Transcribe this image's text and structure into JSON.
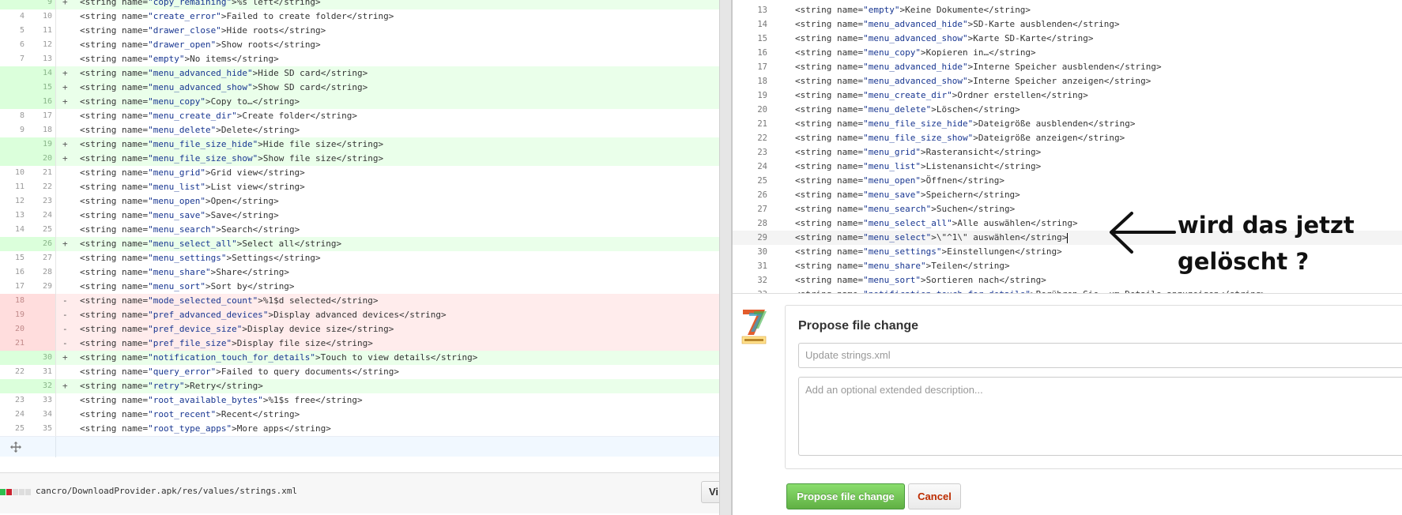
{
  "diff": {
    "lines": [
      {
        "type": "add",
        "old": "",
        "new": "9",
        "marker": "+",
        "name": "copy_remaining",
        "text": "%s left"
      },
      {
        "type": "ctx",
        "old": "4",
        "new": "10",
        "marker": "",
        "name": "create_error",
        "text": "Failed to create folder"
      },
      {
        "type": "ctx",
        "old": "5",
        "new": "11",
        "marker": "",
        "name": "drawer_close",
        "text": "Hide roots"
      },
      {
        "type": "ctx",
        "old": "6",
        "new": "12",
        "marker": "",
        "name": "drawer_open",
        "text": "Show roots"
      },
      {
        "type": "ctx",
        "old": "7",
        "new": "13",
        "marker": "",
        "name": "empty",
        "text": "No items"
      },
      {
        "type": "add",
        "old": "",
        "new": "14",
        "marker": "+",
        "name": "menu_advanced_hide",
        "text": "Hide SD card"
      },
      {
        "type": "add",
        "old": "",
        "new": "15",
        "marker": "+",
        "name": "menu_advanced_show",
        "text": "Show SD card"
      },
      {
        "type": "add",
        "old": "",
        "new": "16",
        "marker": "+",
        "name": "menu_copy",
        "text": "Copy to…"
      },
      {
        "type": "ctx",
        "old": "8",
        "new": "17",
        "marker": "",
        "name": "menu_create_dir",
        "text": "Create folder"
      },
      {
        "type": "ctx",
        "old": "9",
        "new": "18",
        "marker": "",
        "name": "menu_delete",
        "text": "Delete"
      },
      {
        "type": "add",
        "old": "",
        "new": "19",
        "marker": "+",
        "name": "menu_file_size_hide",
        "text": "Hide file size"
      },
      {
        "type": "add",
        "old": "",
        "new": "20",
        "marker": "+",
        "name": "menu_file_size_show",
        "text": "Show file size"
      },
      {
        "type": "ctx",
        "old": "10",
        "new": "21",
        "marker": "",
        "name": "menu_grid",
        "text": "Grid view"
      },
      {
        "type": "ctx",
        "old": "11",
        "new": "22",
        "marker": "",
        "name": "menu_list",
        "text": "List view"
      },
      {
        "type": "ctx",
        "old": "12",
        "new": "23",
        "marker": "",
        "name": "menu_open",
        "text": "Open"
      },
      {
        "type": "ctx",
        "old": "13",
        "new": "24",
        "marker": "",
        "name": "menu_save",
        "text": "Save"
      },
      {
        "type": "ctx",
        "old": "14",
        "new": "25",
        "marker": "",
        "name": "menu_search",
        "text": "Search"
      },
      {
        "type": "add",
        "old": "",
        "new": "26",
        "marker": "+",
        "name": "menu_select_all",
        "text": "Select all"
      },
      {
        "type": "ctx",
        "old": "15",
        "new": "27",
        "marker": "",
        "name": "menu_settings",
        "text": "Settings"
      },
      {
        "type": "ctx",
        "old": "16",
        "new": "28",
        "marker": "",
        "name": "menu_share",
        "text": "Share"
      },
      {
        "type": "ctx",
        "old": "17",
        "new": "29",
        "marker": "",
        "name": "menu_sort",
        "text": "Sort by"
      },
      {
        "type": "del",
        "old": "18",
        "new": "",
        "marker": "-",
        "name": "mode_selected_count",
        "text": "%1$d selected"
      },
      {
        "type": "del",
        "old": "19",
        "new": "",
        "marker": "-",
        "name": "pref_advanced_devices",
        "text": "Display advanced devices"
      },
      {
        "type": "del",
        "old": "20",
        "new": "",
        "marker": "-",
        "name": "pref_device_size",
        "text": "Display device size"
      },
      {
        "type": "del",
        "old": "21",
        "new": "",
        "marker": "-",
        "name": "pref_file_size",
        "text": "Display file size"
      },
      {
        "type": "add",
        "old": "",
        "new": "30",
        "marker": "+",
        "name": "notification_touch_for_details",
        "text": "Touch to view details"
      },
      {
        "type": "ctx",
        "old": "22",
        "new": "31",
        "marker": "",
        "name": "query_error",
        "text": "Failed to query documents"
      },
      {
        "type": "add",
        "old": "",
        "new": "32",
        "marker": "+",
        "name": "retry",
        "text": "Retry"
      },
      {
        "type": "ctx",
        "old": "23",
        "new": "33",
        "marker": "",
        "name": "root_available_bytes",
        "text": "%1$s free"
      },
      {
        "type": "ctx",
        "old": "24",
        "new": "34",
        "marker": "",
        "name": "root_recent",
        "text": "Recent"
      },
      {
        "type": "ctx",
        "old": "25",
        "new": "35",
        "marker": "",
        "name": "root_type_apps",
        "text": "More apps"
      }
    ],
    "file_path": "cancro/DownloadProvider.apk/res/values/strings.xml",
    "view_button": "Vi"
  },
  "editor": {
    "lines": [
      {
        "num": "13",
        "name": "empty",
        "text": "Keine Dokumente"
      },
      {
        "num": "14",
        "name": "menu_advanced_hide",
        "text": "SD-Karte ausblenden"
      },
      {
        "num": "15",
        "name": "menu_advanced_show",
        "text": "Karte SD-Karte"
      },
      {
        "num": "16",
        "name": "menu_copy",
        "text": "Kopieren in…"
      },
      {
        "num": "17",
        "name": "menu_advanced_hide",
        "text": "Interne Speicher ausblenden"
      },
      {
        "num": "18",
        "name": "menu_advanced_show",
        "text": "Interne Speicher anzeigen"
      },
      {
        "num": "19",
        "name": "menu_create_dir",
        "text": "Ordner erstellen"
      },
      {
        "num": "20",
        "name": "menu_delete",
        "text": "Löschen"
      },
      {
        "num": "21",
        "name": "menu_file_size_hide",
        "text": "Dateigröße ausblenden"
      },
      {
        "num": "22",
        "name": "menu_file_size_show",
        "text": "Dateigröße anzeigen"
      },
      {
        "num": "23",
        "name": "menu_grid",
        "text": "Rasteransicht"
      },
      {
        "num": "24",
        "name": "menu_list",
        "text": "Listenansicht"
      },
      {
        "num": "25",
        "name": "menu_open",
        "text": "Öffnen"
      },
      {
        "num": "26",
        "name": "menu_save",
        "text": "Speichern"
      },
      {
        "num": "27",
        "name": "menu_search",
        "text": "Suchen"
      },
      {
        "num": "28",
        "name": "menu_select_all",
        "text": "Alle auswählen"
      },
      {
        "num": "29",
        "name": "menu_select",
        "text": "\\\"^1\\\" auswählen",
        "current": true
      },
      {
        "num": "30",
        "name": "menu_settings",
        "text": "Einstellungen"
      },
      {
        "num": "31",
        "name": "menu_share",
        "text": "Teilen"
      },
      {
        "num": "32",
        "name": "menu_sort",
        "text": "Sortieren nach"
      },
      {
        "num": "33",
        "name": "notification_touch_for_details",
        "text": "Berühren Sie, um Details anzuzeigen"
      }
    ]
  },
  "annotation": {
    "line1": "wird das jetzt",
    "line2": "gelöscht ?"
  },
  "propose": {
    "title": "Propose file change",
    "summary_placeholder": "Update strings.xml",
    "description_placeholder": "Add an optional extended description...",
    "submit_label": "Propose file change",
    "cancel_label": "Cancel"
  },
  "colors": {
    "add_bg": "#eaffea",
    "del_bg": "#ffecec",
    "string_value": "#183691",
    "submit_green": "#60b044",
    "cancel_red": "#bd2c00"
  }
}
